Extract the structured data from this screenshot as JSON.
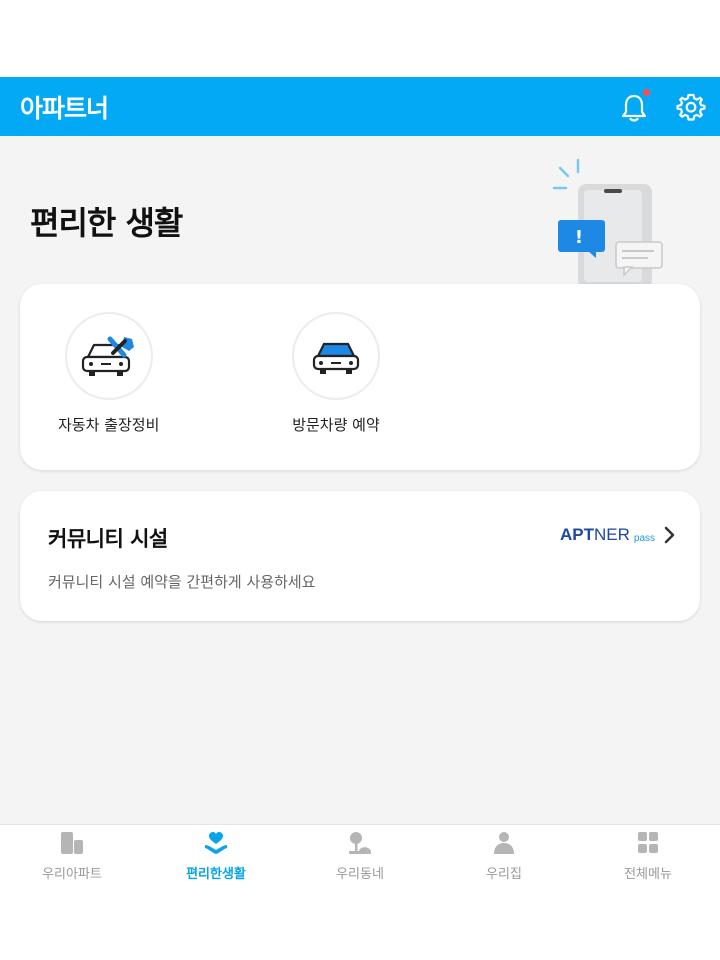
{
  "app": {
    "title": "아파트너"
  },
  "header": {
    "bell_icon": "bell-icon",
    "settings_icon": "gear-icon",
    "notification_dot_color": "#ff4d4f",
    "brand_color": "#03a9f4"
  },
  "page": {
    "title": "편리한 생활"
  },
  "services": {
    "items": [
      {
        "label": "자동차 출장정비",
        "icon": "car-repair-icon"
      },
      {
        "label": "방문차량 예약",
        "icon": "car-visit-icon"
      }
    ]
  },
  "community": {
    "title": "커뮤니티 시설",
    "description": "커뮤니티 시설 예약을 간편하게 사용하세요",
    "brand_apt": "APT",
    "brand_ner": "NER",
    "brand_pass": "pass"
  },
  "tabs": [
    {
      "label": "우리아파트",
      "icon": "building-icon",
      "active": false
    },
    {
      "label": "편리한생활",
      "icon": "heart-hand-icon",
      "active": true
    },
    {
      "label": "우리동네",
      "icon": "neighborhood-icon",
      "active": false
    },
    {
      "label": "우리집",
      "icon": "person-icon",
      "active": false
    },
    {
      "label": "전체메뉴",
      "icon": "grid-menu-icon",
      "active": false
    }
  ]
}
